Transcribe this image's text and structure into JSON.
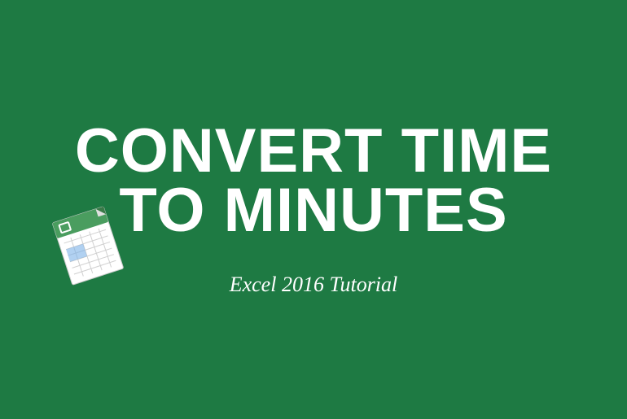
{
  "title": "CONVERT TIME TO MINUTES",
  "subtitle": "Excel 2016 Tutorial",
  "colors": {
    "background": "#1e7a43",
    "text": "#ffffff"
  },
  "icon": {
    "name": "spreadsheet-icon",
    "type": "excel-document"
  }
}
